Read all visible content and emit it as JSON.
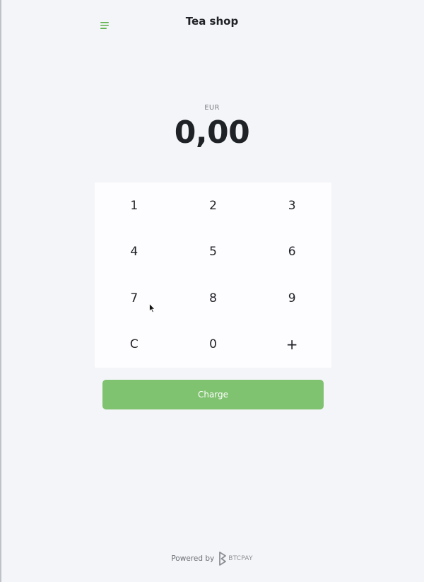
{
  "header": {
    "title": "Tea shop",
    "menu_icon": "hamburger-menu-icon",
    "accent_color": "#5ab047"
  },
  "display": {
    "currency": "EUR",
    "amount": "0,00"
  },
  "keypad": {
    "keys": [
      "1",
      "2",
      "3",
      "4",
      "5",
      "6",
      "7",
      "8",
      "9",
      "C",
      "0",
      "+"
    ]
  },
  "charge": {
    "label": "Charge",
    "color": "#7fc270"
  },
  "footer": {
    "powered_by": "Powered by",
    "brand": "BTCPAY"
  }
}
